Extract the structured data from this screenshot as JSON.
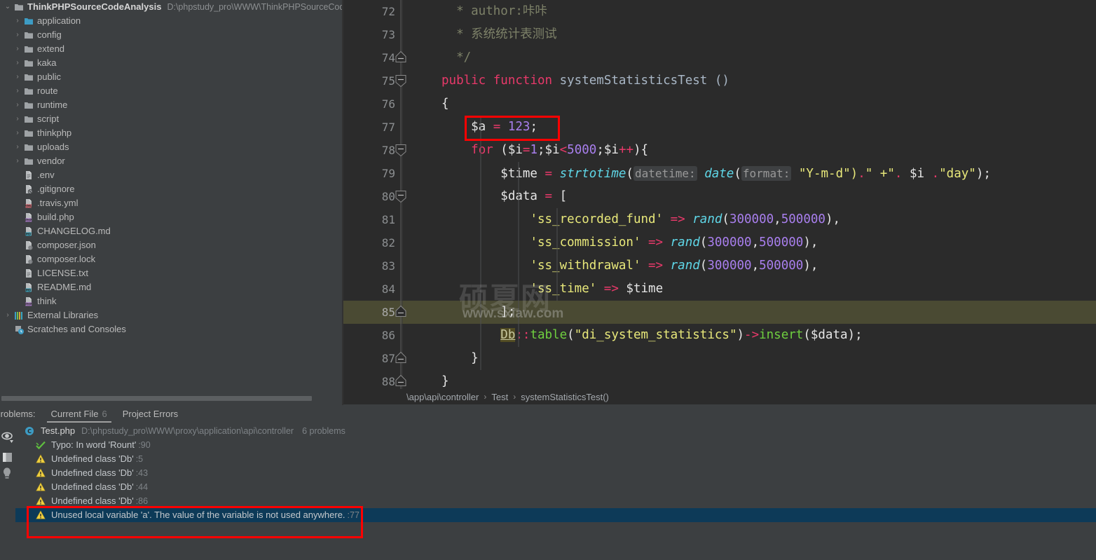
{
  "project": {
    "root_label": "ThinkPHPSourceCodeAnalysis",
    "root_path": "D:\\phpstudy_pro\\WWW\\ThinkPHPSourceCode",
    "items": [
      {
        "label": "application",
        "type": "folder-open",
        "expandable": true
      },
      {
        "label": "config",
        "type": "folder",
        "expandable": true
      },
      {
        "label": "extend",
        "type": "folder",
        "expandable": true
      },
      {
        "label": "kaka",
        "type": "folder",
        "expandable": true
      },
      {
        "label": "public",
        "type": "folder",
        "expandable": true
      },
      {
        "label": "route",
        "type": "folder",
        "expandable": true
      },
      {
        "label": "runtime",
        "type": "folder",
        "expandable": true
      },
      {
        "label": "script",
        "type": "folder",
        "expandable": true
      },
      {
        "label": "thinkphp",
        "type": "folder",
        "expandable": true
      },
      {
        "label": "uploads",
        "type": "folder",
        "expandable": true
      },
      {
        "label": "vendor",
        "type": "folder",
        "expandable": true
      },
      {
        "label": ".env",
        "type": "file-text",
        "expandable": false
      },
      {
        "label": ".gitignore",
        "type": "file-ignore",
        "expandable": false
      },
      {
        "label": ".travis.yml",
        "type": "file-yml",
        "expandable": false
      },
      {
        "label": "build.php",
        "type": "file-php",
        "expandable": false
      },
      {
        "label": "CHANGELOG.md",
        "type": "file-md",
        "expandable": false
      },
      {
        "label": "composer.json",
        "type": "file-json",
        "expandable": false
      },
      {
        "label": "composer.lock",
        "type": "file-json",
        "expandable": false
      },
      {
        "label": "LICENSE.txt",
        "type": "file-text",
        "expandable": false
      },
      {
        "label": "README.md",
        "type": "file-md",
        "expandable": false
      },
      {
        "label": "think",
        "type": "file-php",
        "expandable": false
      }
    ],
    "external_libraries": "External Libraries",
    "scratches": "Scratches and Consoles"
  },
  "editor": {
    "first_line": 72,
    "current_line": 85,
    "lines": [
      {
        "n": 72,
        "spans": [
          {
            "t": "  * author:咔咔",
            "c": "c-cmt"
          }
        ]
      },
      {
        "n": 73,
        "spans": [
          {
            "t": "  * 系统统计表测试",
            "c": "c-cmt"
          }
        ]
      },
      {
        "n": 74,
        "spans": [
          {
            "t": "  */",
            "c": "c-cmt"
          }
        ]
      },
      {
        "n": 75,
        "spans": [
          {
            "t": "public",
            "c": "c-kw"
          },
          {
            "t": " ",
            "c": "c-plain"
          },
          {
            "t": "function",
            "c": "c-kw"
          },
          {
            "t": " ",
            "c": "c-plain"
          },
          {
            "t": "systemStatisticsTest",
            "c": "c-fnname"
          },
          {
            "t": " ",
            "c": "c-plain"
          },
          {
            "t": "()",
            "c": "c-paren"
          }
        ]
      },
      {
        "n": 76,
        "spans": [
          {
            "t": "{",
            "c": "c-plain"
          }
        ]
      },
      {
        "n": 77,
        "spans": [
          {
            "t": "    $a",
            "c": "c-var"
          },
          {
            "t": " = ",
            "c": "c-op"
          },
          {
            "t": "123",
            "c": "c-num"
          },
          {
            "t": ";",
            "c": "c-plain"
          }
        ]
      },
      {
        "n": 78,
        "spans": [
          {
            "t": "    ",
            "c": "c-plain"
          },
          {
            "t": "for",
            "c": "c-kw"
          },
          {
            "t": " ($i",
            "c": "c-plain"
          },
          {
            "t": "=",
            "c": "c-op"
          },
          {
            "t": "1",
            "c": "c-num"
          },
          {
            "t": ";$i",
            "c": "c-plain"
          },
          {
            "t": "<",
            "c": "c-op"
          },
          {
            "t": "5000",
            "c": "c-num"
          },
          {
            "t": ";$i",
            "c": "c-plain"
          },
          {
            "t": "++",
            "c": "c-op"
          },
          {
            "t": "){",
            "c": "c-plain"
          }
        ]
      },
      {
        "n": 79,
        "spans": [
          {
            "t": "        $time",
            "c": "c-plain"
          },
          {
            "t": " = ",
            "c": "c-op"
          },
          {
            "t": "strtotime",
            "c": "c-fn c-ital"
          },
          {
            "t": "(",
            "c": "c-plain"
          },
          {
            "t": "datetime:",
            "c": "hint"
          },
          {
            "t": " ",
            "c": "c-plain"
          },
          {
            "t": "date",
            "c": "c-fn c-ital"
          },
          {
            "t": "(",
            "c": "c-plain"
          },
          {
            "t": "format:",
            "c": "hint"
          },
          {
            "t": " ",
            "c": "c-plain"
          },
          {
            "t": "\"Y-m-d\")",
            "c": "c-str"
          },
          {
            "t": ".",
            "c": "c-op"
          },
          {
            "t": "\" +\"",
            "c": "c-str"
          },
          {
            "t": ".",
            "c": "c-op"
          },
          {
            "t": " $i ",
            "c": "c-plain"
          },
          {
            "t": ".",
            "c": "c-op"
          },
          {
            "t": "\"day\"",
            "c": "c-str"
          },
          {
            "t": ");",
            "c": "c-plain"
          }
        ]
      },
      {
        "n": 80,
        "spans": [
          {
            "t": "        $data",
            "c": "c-plain"
          },
          {
            "t": " = ",
            "c": "c-op"
          },
          {
            "t": "[",
            "c": "c-plain"
          }
        ]
      },
      {
        "n": 81,
        "spans": [
          {
            "t": "            ",
            "c": "c-plain"
          },
          {
            "t": "'ss_recorded_fund'",
            "c": "c-str"
          },
          {
            "t": " => ",
            "c": "c-op"
          },
          {
            "t": "rand",
            "c": "c-fn c-ital"
          },
          {
            "t": "(",
            "c": "c-plain"
          },
          {
            "t": "300000",
            "c": "c-num"
          },
          {
            "t": ",",
            "c": "c-plain"
          },
          {
            "t": "500000",
            "c": "c-num"
          },
          {
            "t": "),",
            "c": "c-plain"
          }
        ]
      },
      {
        "n": 82,
        "spans": [
          {
            "t": "            ",
            "c": "c-plain"
          },
          {
            "t": "'ss_commission'",
            "c": "c-str"
          },
          {
            "t": " => ",
            "c": "c-op"
          },
          {
            "t": "rand",
            "c": "c-fn c-ital"
          },
          {
            "t": "(",
            "c": "c-plain"
          },
          {
            "t": "300000",
            "c": "c-num"
          },
          {
            "t": ",",
            "c": "c-plain"
          },
          {
            "t": "500000",
            "c": "c-num"
          },
          {
            "t": "),",
            "c": "c-plain"
          }
        ]
      },
      {
        "n": 83,
        "spans": [
          {
            "t": "            ",
            "c": "c-plain"
          },
          {
            "t": "'ss_withdrawal'",
            "c": "c-str"
          },
          {
            "t": " => ",
            "c": "c-op"
          },
          {
            "t": "rand",
            "c": "c-fn c-ital"
          },
          {
            "t": "(",
            "c": "c-plain"
          },
          {
            "t": "300000",
            "c": "c-num"
          },
          {
            "t": ",",
            "c": "c-plain"
          },
          {
            "t": "500000",
            "c": "c-num"
          },
          {
            "t": "),",
            "c": "c-plain"
          }
        ]
      },
      {
        "n": 84,
        "spans": [
          {
            "t": "            ",
            "c": "c-plain"
          },
          {
            "t": "'ss_time'",
            "c": "c-str"
          },
          {
            "t": " => ",
            "c": "c-op"
          },
          {
            "t": "$time",
            "c": "c-plain"
          }
        ]
      },
      {
        "n": 85,
        "spans": [
          {
            "t": "        ];",
            "c": "c-plain"
          }
        ]
      },
      {
        "n": 86,
        "spans": [
          {
            "t": "        ",
            "c": "c-plain"
          },
          {
            "t": "Db",
            "c": "db"
          },
          {
            "t": "::",
            "c": "c-op"
          },
          {
            "t": "table",
            "c": "c-fn2"
          },
          {
            "t": "(",
            "c": "c-plain"
          },
          {
            "t": "\"di_system_statistics\"",
            "c": "c-str"
          },
          {
            "t": ")",
            "c": "c-plain"
          },
          {
            "t": "->",
            "c": "c-op"
          },
          {
            "t": "insert",
            "c": "c-fn2"
          },
          {
            "t": "($data);",
            "c": "c-plain"
          }
        ]
      },
      {
        "n": 87,
        "spans": [
          {
            "t": "    }",
            "c": "c-plain"
          }
        ]
      },
      {
        "n": 88,
        "spans": [
          {
            "t": "}",
            "c": "c-plain"
          }
        ]
      }
    ],
    "watermark_cn": "硕夏网",
    "watermark_url": "www.sxiaw.com"
  },
  "breadcrumb": {
    "parts": [
      "\\app\\api\\controller",
      "Test",
      "systemStatisticsTest()"
    ],
    "separator": "›"
  },
  "problems": {
    "title": "Problems:",
    "tabs": [
      {
        "label": "Current File",
        "count": "6",
        "active": true
      },
      {
        "label": "Project Errors",
        "count": "",
        "active": false
      }
    ],
    "file": {
      "name": "Test.php",
      "path": "D:\\phpstudy_pro\\WWW\\proxy\\application\\api\\controller",
      "count": "6 problems"
    },
    "entries": [
      {
        "severity": "typo",
        "text": "Typo: In word 'Rount'",
        "line": ":90",
        "selected": false
      },
      {
        "severity": "warning",
        "text": "Undefined class 'Db'",
        "line": ":5",
        "selected": false
      },
      {
        "severity": "warning",
        "text": "Undefined class 'Db'",
        "line": ":43",
        "selected": false
      },
      {
        "severity": "warning",
        "text": "Undefined class 'Db'",
        "line": ":44",
        "selected": false
      },
      {
        "severity": "warning",
        "text": "Undefined class 'Db'",
        "line": ":86",
        "selected": false
      },
      {
        "severity": "warning",
        "text": "Unused local variable 'a'. The value of the variable is not used anywhere.",
        "line": ":77",
        "selected": true
      }
    ]
  },
  "colors": {
    "bg_panel": "#3c3f41",
    "bg_editor": "#2b2b2b",
    "accent_selection": "#0d3a58",
    "annotation_red": "#ff0000",
    "current_line": "#4a4a33"
  }
}
